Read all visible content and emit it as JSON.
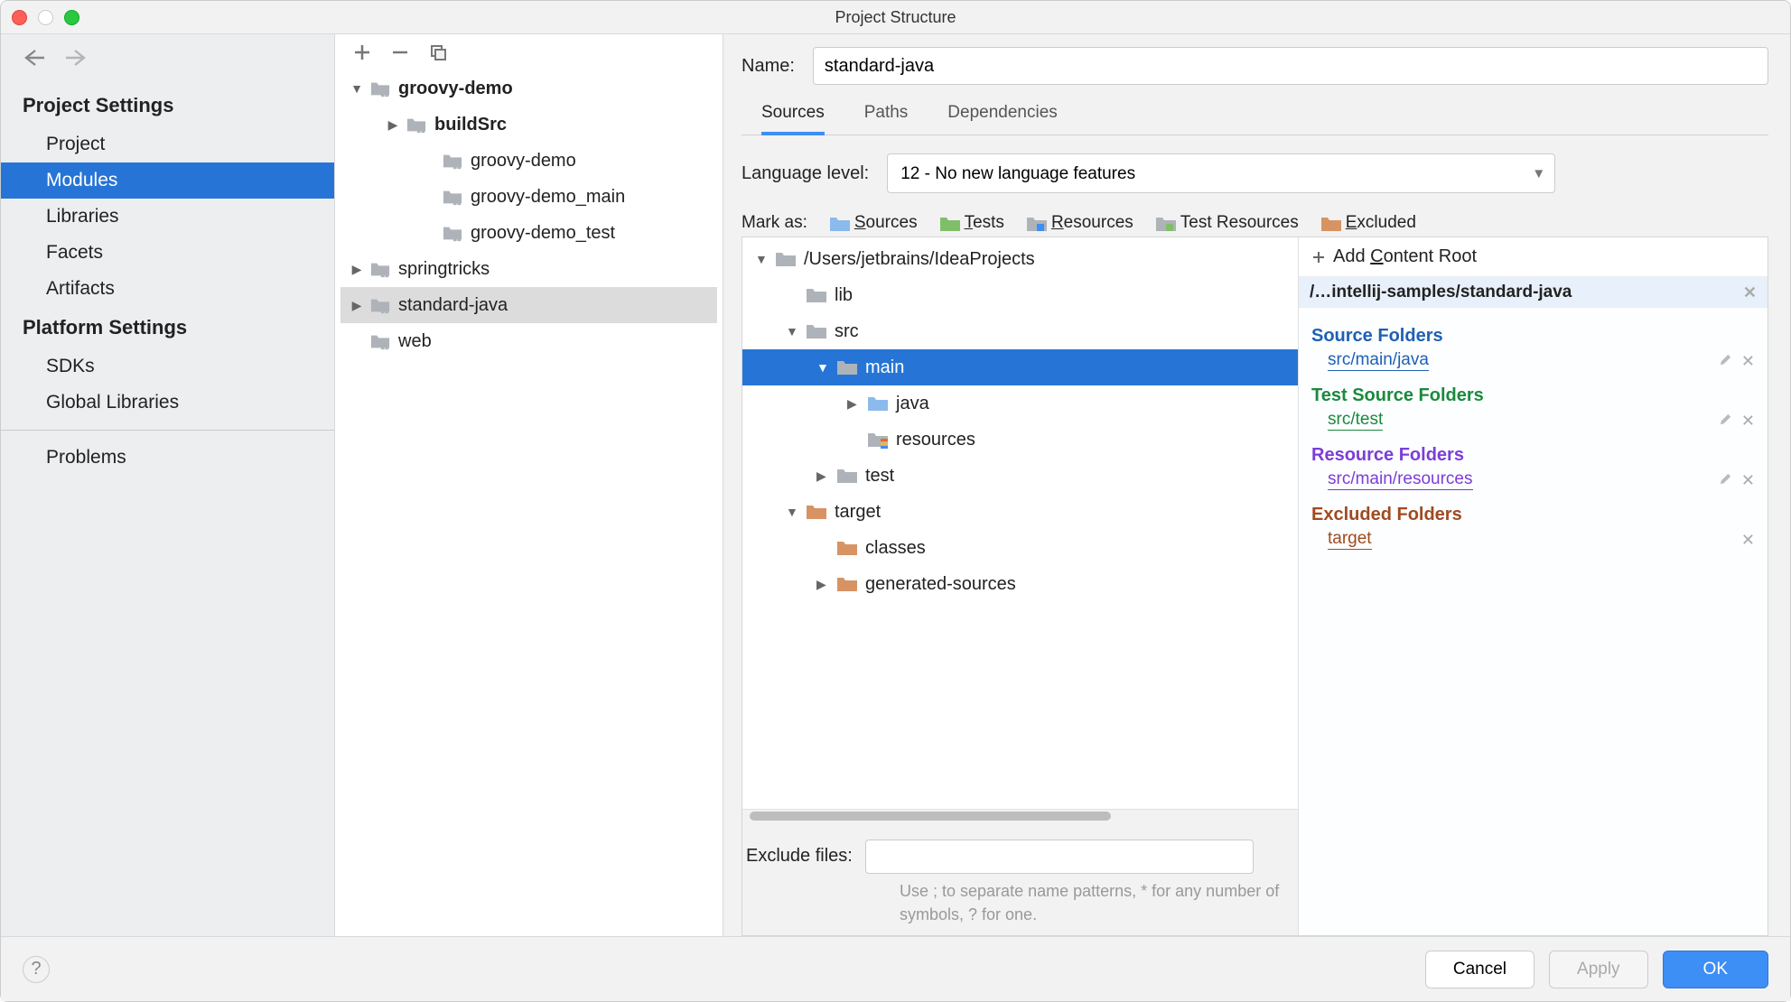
{
  "window": {
    "title": "Project Structure"
  },
  "nav": {
    "section1": "Project Settings",
    "items1": [
      "Project",
      "Modules",
      "Libraries",
      "Facets",
      "Artifacts"
    ],
    "section2": "Platform Settings",
    "items2": [
      "SDKs",
      "Global Libraries"
    ],
    "problems": "Problems",
    "selected": "Modules"
  },
  "modules": {
    "tree": [
      {
        "label": "groovy-demo",
        "depth": 0,
        "arrow": "down",
        "icon": "module",
        "bold": true
      },
      {
        "label": "buildSrc",
        "depth": 1,
        "arrow": "right",
        "icon": "module",
        "bold": true
      },
      {
        "label": "groovy-demo",
        "depth": 2,
        "arrow": "",
        "icon": "module"
      },
      {
        "label": "groovy-demo_main",
        "depth": 2,
        "arrow": "",
        "icon": "module"
      },
      {
        "label": "groovy-demo_test",
        "depth": 2,
        "arrow": "",
        "icon": "module"
      },
      {
        "label": "springtricks",
        "depth": 0,
        "arrow": "right",
        "icon": "module"
      },
      {
        "label": "standard-java",
        "depth": 0,
        "arrow": "right",
        "icon": "module",
        "selected": true
      },
      {
        "label": "web",
        "depth": 0,
        "arrow": "",
        "icon": "module"
      }
    ]
  },
  "detail": {
    "name_label": "Name:",
    "name_value": "standard-java",
    "tabs": [
      "Sources",
      "Paths",
      "Dependencies"
    ],
    "active_tab": "Sources",
    "lang_label": "Language level:",
    "lang_value": "12 - No new language features",
    "markas_label": "Mark as:",
    "mark_buttons": [
      {
        "label": "Sources",
        "u": "S",
        "color": "#8bbaed"
      },
      {
        "label": "Tests",
        "u": "T",
        "color": "#7fbf6a"
      },
      {
        "label": "Resources",
        "u": "R",
        "color": "#aeb3b9",
        "over": "#3d8ef5"
      },
      {
        "label": "Test Resources",
        "u": "",
        "color": "#aeb3b9",
        "over": "#7fbf6a"
      },
      {
        "label": "Excluded",
        "u": "E",
        "color": "#d89364"
      }
    ],
    "folder_tree": [
      {
        "label": "/Users/jetbrains/IdeaProjects",
        "depth": 0,
        "arrow": "down",
        "icon": "folder"
      },
      {
        "label": "lib",
        "depth": 1,
        "arrow": "",
        "icon": "folder"
      },
      {
        "label": "src",
        "depth": 1,
        "arrow": "down",
        "icon": "folder"
      },
      {
        "label": "main",
        "depth": 2,
        "arrow": "down",
        "icon": "folder",
        "selected": true
      },
      {
        "label": "java",
        "depth": 3,
        "arrow": "right",
        "icon": "folder-blue"
      },
      {
        "label": "resources",
        "depth": 3,
        "arrow": "",
        "icon": "folder-res"
      },
      {
        "label": "test",
        "depth": 2,
        "arrow": "right",
        "icon": "folder"
      },
      {
        "label": "target",
        "depth": 1,
        "arrow": "down",
        "icon": "folder-brown"
      },
      {
        "label": "classes",
        "depth": 2,
        "arrow": "",
        "icon": "folder-brown"
      },
      {
        "label": "generated-sources",
        "depth": 2,
        "arrow": "right",
        "icon": "folder-brown"
      }
    ],
    "exclude_label": "Exclude files:",
    "exclude_hint": "Use ; to separate name patterns, * for any number of symbols, ? for one.",
    "add_content_root": "Add Content Root",
    "content_root_path": "/…intellij-samples/standard-java",
    "categories": [
      {
        "head": "Source Folders",
        "cls": "blue",
        "items": [
          "src/main/java"
        ],
        "editable": true
      },
      {
        "head": "Test Source Folders",
        "cls": "green",
        "items": [
          "src/test"
        ],
        "editable": true
      },
      {
        "head": "Resource Folders",
        "cls": "purple",
        "items": [
          "src/main/resources"
        ],
        "editable": true
      },
      {
        "head": "Excluded Folders",
        "cls": "brown",
        "items": [
          "target"
        ],
        "editable": false
      }
    ]
  },
  "footer": {
    "cancel": "Cancel",
    "apply": "Apply",
    "ok": "OK"
  }
}
